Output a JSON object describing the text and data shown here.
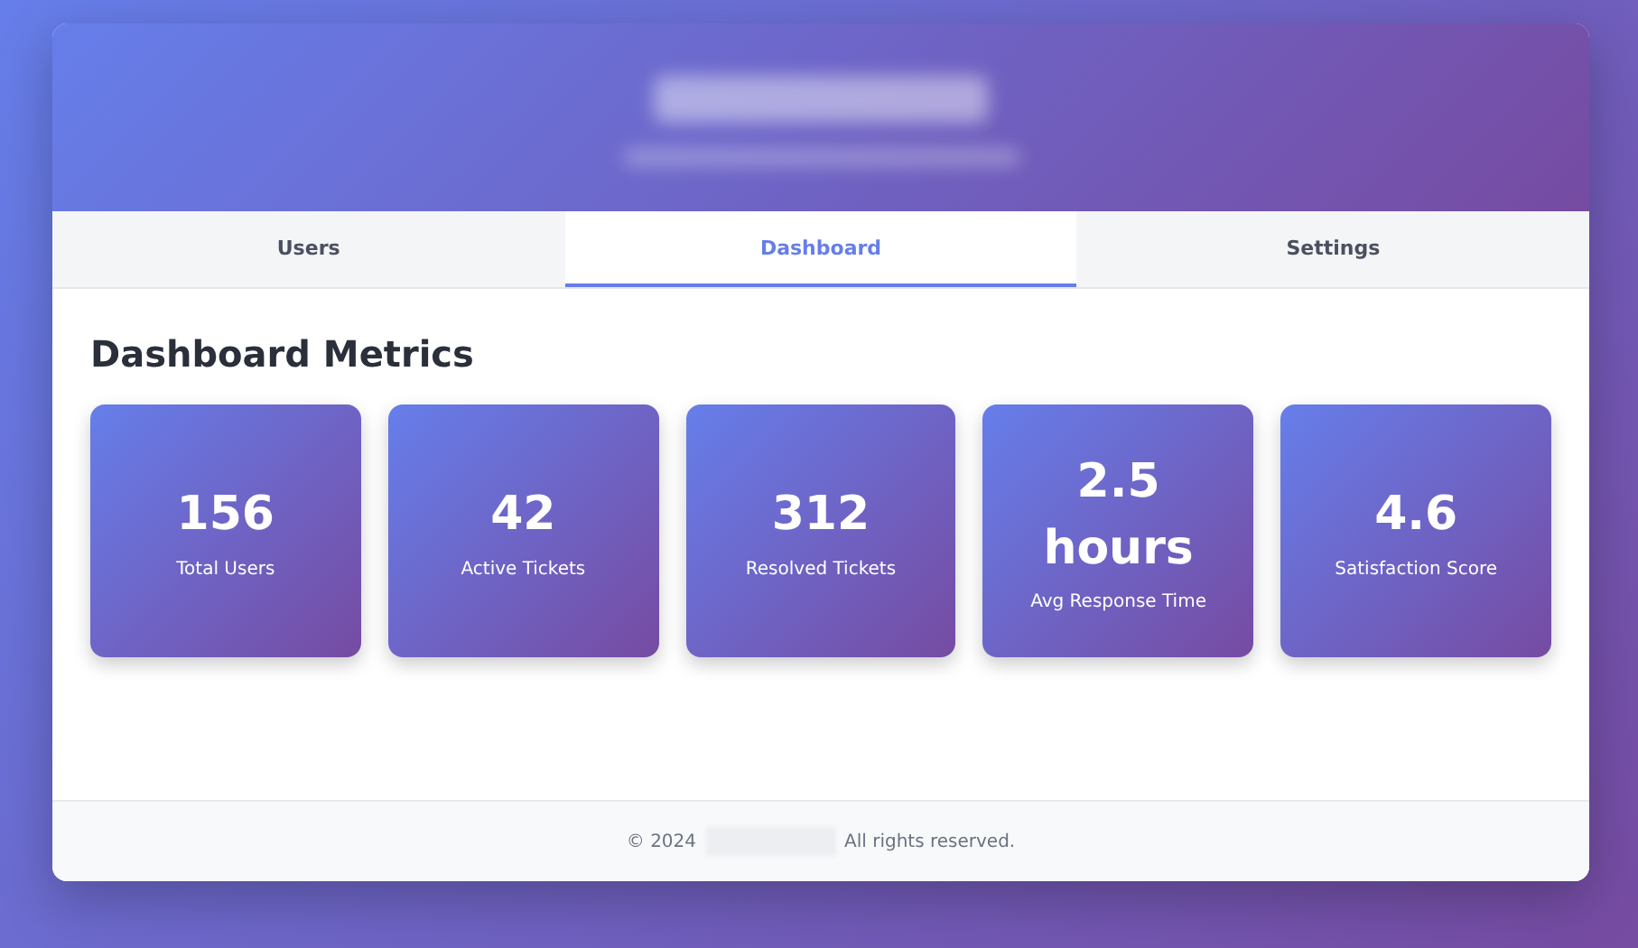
{
  "tabs": [
    {
      "label": "Users",
      "selected": false
    },
    {
      "label": "Dashboard",
      "selected": true
    },
    {
      "label": "Settings",
      "selected": false
    }
  ],
  "section_title": "Dashboard Metrics",
  "metrics": [
    {
      "value": "156",
      "label": "Total Users"
    },
    {
      "value": "42",
      "label": "Active Tickets"
    },
    {
      "value": "312",
      "label": "Resolved Tickets"
    },
    {
      "value": "2.5 hours",
      "label": "Avg Response Time"
    },
    {
      "value": "4.6",
      "label": "Satisfaction Score"
    }
  ],
  "footer": {
    "copyright": "© 2024",
    "rights": "All rights reserved."
  }
}
